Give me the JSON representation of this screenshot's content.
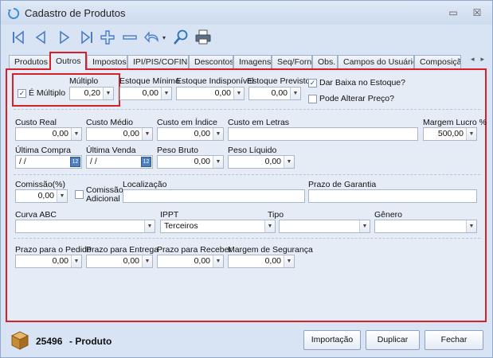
{
  "window": {
    "title": "Cadastro de Produtos",
    "minimize_glyph": "▭",
    "restore_glyph": "☒"
  },
  "toolbar": {
    "icons": [
      "first-record-icon",
      "previous-record-icon",
      "next-record-icon",
      "last-record-icon",
      "add-icon",
      "remove-icon",
      "undo-icon",
      "search-icon",
      "print-icon"
    ]
  },
  "tabs": [
    "Produtos",
    "Outros",
    "Impostos",
    "IPI/PIS/COFINS",
    "Descontos",
    "Imagens",
    "Seq/Forn",
    "Obs.",
    "Campos do Usuário",
    "Composiçã"
  ],
  "active_tab": "Outros",
  "form": {
    "e_multiplo": {
      "label": "É Múltiplo",
      "checked": true
    },
    "multiplo": {
      "label": "Múltiplo",
      "value": "0,20"
    },
    "estoque_minimo": {
      "label": "Estoque Mínimo",
      "value": "0,00"
    },
    "estoque_indisponivel": {
      "label": "Estoque Indisponível",
      "value": "0,00"
    },
    "estoque_previsto": {
      "label": "Estoque Previsto",
      "value": "0,00"
    },
    "dar_baixa": {
      "label": "Dar Baixa no Estoque?",
      "checked": true
    },
    "alterar_preco": {
      "label": "Pode Alterar Preço?",
      "checked": false
    },
    "custo_real": {
      "label": "Custo Real",
      "value": "0,00"
    },
    "custo_medio": {
      "label": "Custo Médio",
      "value": "0,00"
    },
    "custo_indice": {
      "label": "Custo em Índice",
      "value": "0,00"
    },
    "custo_letras": {
      "label": "Custo em Letras",
      "value": ""
    },
    "margem_lucro": {
      "label": "Margem Lucro %",
      "value": "500,00"
    },
    "ultima_compra": {
      "label": "Última Compra",
      "value": "/ /"
    },
    "ultima_venda": {
      "label": "Última Venda",
      "value": "/ /"
    },
    "peso_bruto": {
      "label": "Peso Bruto",
      "value": "0,00"
    },
    "peso_liquido": {
      "label": "Peso Líquido",
      "value": "0,00"
    },
    "comissao": {
      "label": "Comissão(%)",
      "value": "0,00"
    },
    "comissao_adicional": {
      "label_line1": "Comissão",
      "label_line2": "Adicional",
      "checked": false
    },
    "localizacao": {
      "label": "Localização",
      "value": ""
    },
    "prazo_garantia": {
      "label": "Prazo de Garantia",
      "value": ""
    },
    "curva_abc": {
      "label": "Curva ABC",
      "value": ""
    },
    "ippt": {
      "label": "IPPT",
      "value": "Terceiros"
    },
    "tipo": {
      "label": "Tipo",
      "value": ""
    },
    "genero": {
      "label": "Gênero",
      "value": ""
    },
    "prazo_pedido": {
      "label": "Prazo para o Pedido",
      "value": "0,00"
    },
    "prazo_entrega": {
      "label": "Prazo para Entrega",
      "value": "0,00"
    },
    "prazo_receber": {
      "label": "Prazo para Receber",
      "value": "0,00"
    },
    "margem_seguranca": {
      "label": "Margem de Segurança",
      "value": "0,00"
    }
  },
  "footer": {
    "product_code": "25496",
    "product_name": "- Produto",
    "importacao_label": "Importação",
    "duplicar_label": "Duplicar",
    "fechar_label": "Fechar"
  },
  "colors": {
    "highlight": "#d6212a",
    "panel": "#e6ecf5",
    "accent": "#4f7fbf"
  }
}
